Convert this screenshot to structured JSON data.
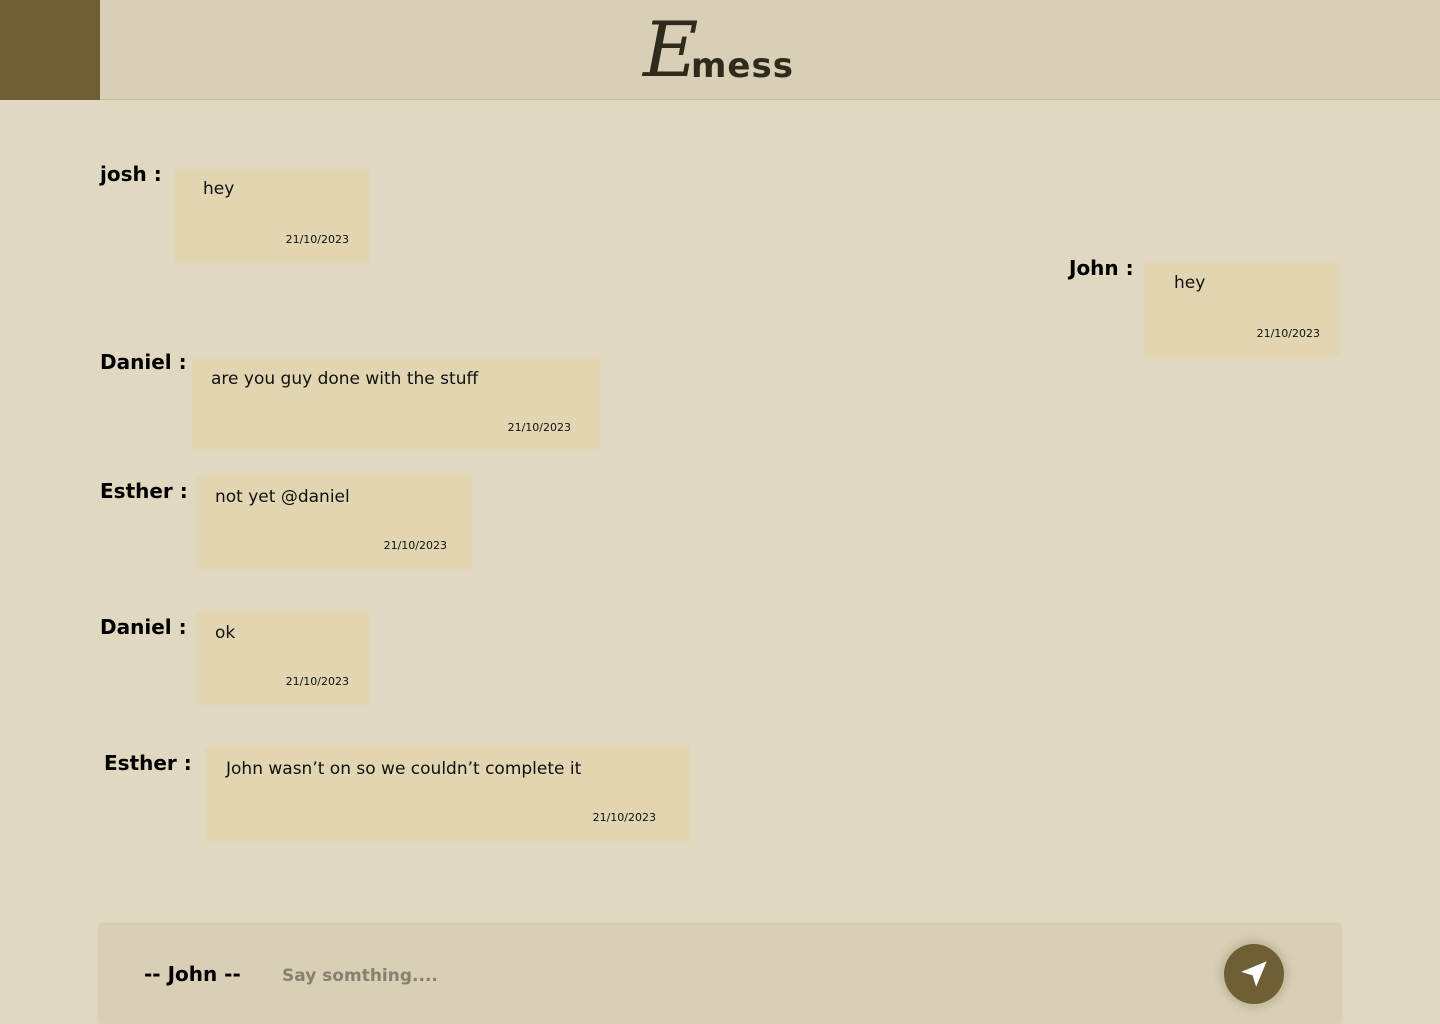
{
  "header": {
    "logo_initial": "E",
    "logo_rest": "mess"
  },
  "messages": [
    {
      "sender": "josh :",
      "text": "hey",
      "date": "21/10/2023",
      "side": "left"
    },
    {
      "sender": "John :",
      "text": "hey",
      "date": "21/10/2023",
      "side": "right"
    },
    {
      "sender": "Daniel :",
      "text": "are you guy done with the stuff",
      "date": "21/10/2023",
      "side": "left"
    },
    {
      "sender": "Esther :",
      "text": "not yet @daniel",
      "date": "21/10/2023",
      "side": "left"
    },
    {
      "sender": "Daniel :",
      "text": "ok",
      "date": "21/10/2023",
      "side": "left"
    },
    {
      "sender": "Esther :",
      "text": "John wasn’t on so we couldn’t complete it",
      "date": "21/10/2023",
      "side": "left"
    }
  ],
  "composer": {
    "current_user": "-- John --",
    "placeholder": "Say somthing....",
    "value": "",
    "send_icon": "send-arrow-icon"
  },
  "colors": {
    "accent": "#6e5f34",
    "background": "#e0d8c0",
    "header": "#d8cfb6",
    "bubble": "#e2d5b2"
  }
}
